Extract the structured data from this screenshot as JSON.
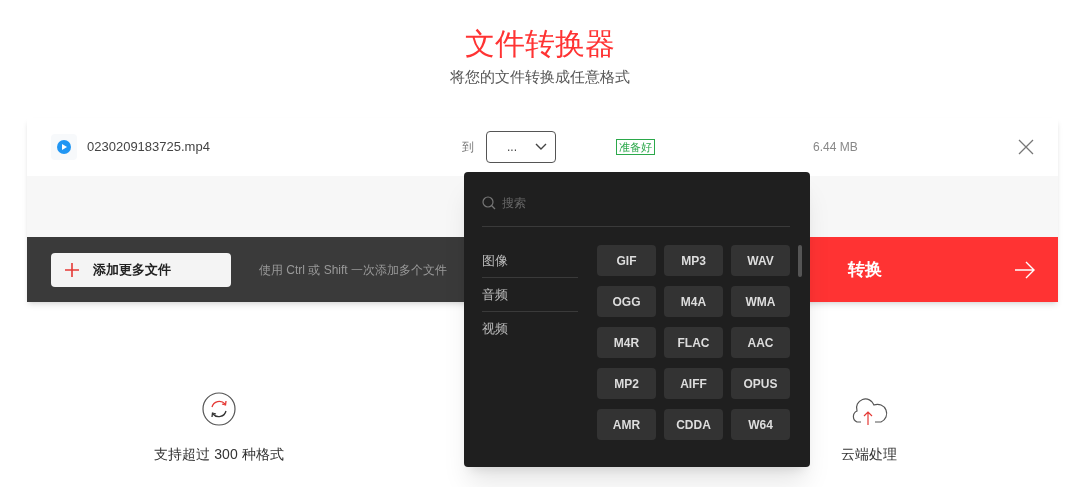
{
  "header": {
    "title": "文件转换器",
    "subtitle": "将您的文件转换成任意格式"
  },
  "file": {
    "name": "0230209183725.mp4",
    "to_label": "到",
    "format_select": "...",
    "status": "准备好",
    "size": "6.44 MB"
  },
  "toolbar": {
    "add_button": "添加更多文件",
    "hint": "使用 Ctrl 或 Shift 一次添加多个文件",
    "convert_button": "转换"
  },
  "dropdown": {
    "search_placeholder": "搜索",
    "categories": [
      "图像",
      "音频",
      "视频"
    ],
    "formats": [
      "GIF",
      "MP3",
      "WAV",
      "OGG",
      "M4A",
      "WMA",
      "M4R",
      "FLAC",
      "AAC",
      "MP2",
      "AIFF",
      "OPUS",
      "AMR",
      "CDDA",
      "W64"
    ]
  },
  "features": [
    {
      "kind": "formats",
      "label": "支持超过 300 种格式"
    },
    {
      "kind": "cloud",
      "label": "云端处理"
    }
  ]
}
